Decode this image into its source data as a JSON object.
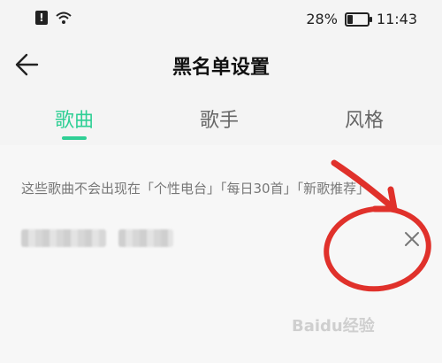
{
  "status_bar": {
    "battery_percent": "28%",
    "battery_level": 0.28,
    "time": "11:43",
    "alert_symbol": "!",
    "icons": [
      "alert-icon",
      "wifi-icon",
      "battery-icon"
    ]
  },
  "header": {
    "title": "黑名单设置",
    "back_icon": "back-arrow-icon"
  },
  "tabs": [
    {
      "label": "歌曲",
      "active": true
    },
    {
      "label": "歌手",
      "active": false
    },
    {
      "label": "风格",
      "active": false
    }
  ],
  "content": {
    "note": "这些歌曲不会出现在「个性电台」「每日30首」「新歌推荐」",
    "items": [
      {
        "name_blurred": true,
        "remove_icon": "close-icon"
      }
    ]
  },
  "annotation": {
    "color": "#e0312b",
    "shapes": [
      "arrow",
      "ellipse"
    ]
  },
  "watermark": {
    "text": "Baidu经验"
  },
  "colors": {
    "accent": "#2fcf95",
    "background": "#f4f4f4",
    "annotation": "#e0312b"
  }
}
